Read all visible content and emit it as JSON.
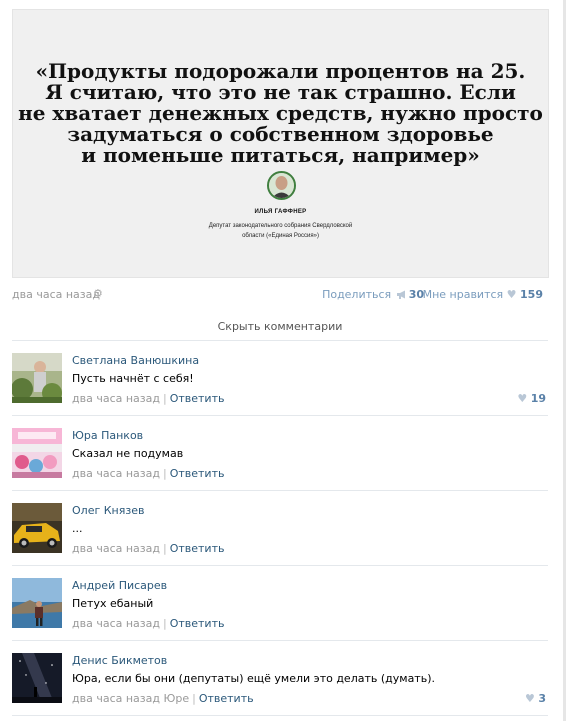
{
  "post": {
    "quote_lines": [
      "«Продукты подорожали процентов на 25.",
      "Я считаю, что это не так страшно. Если",
      "не хватает денежных средств, нужно просто",
      "задуматься о собственном здоровье",
      "и поменьше питаться, например»"
    ],
    "author_name": "ИЛЬЯ ГАФФНЕР",
    "author_role_lines": [
      "Депутат законодательного собрания Свердловской",
      "области («Единая Россия»)"
    ],
    "time": "два часа назад",
    "share_label": "Поделиться",
    "share_count": "30",
    "like_label": "Мне нравится",
    "like_count": "159",
    "hide_comments_label": "Скрыть комментарии"
  },
  "comments": [
    {
      "name": "Светлана Ванюшкина",
      "text": "Пусть начнёт с себя!",
      "time": "два часа назад",
      "reply": "Ответить",
      "likes": "19",
      "avatar": "woman-garden-avatar"
    },
    {
      "name": "Юра Панков",
      "text": "Сказал не подумав",
      "time": "два часа назад",
      "reply": "Ответить",
      "likes": "",
      "avatar": "pink-toys-avatar"
    },
    {
      "name": "Олег Князев",
      "text": "...",
      "time": "два часа назад",
      "reply": "Ответить",
      "likes": "",
      "avatar": "yellow-car-avatar"
    },
    {
      "name": "Андрей Писарев",
      "text": "Петух ебаный",
      "time": "два часа назад",
      "reply": "Ответить",
      "likes": "",
      "avatar": "seaside-man-avatar"
    },
    {
      "name": "Денис Бикметов",
      "text": "Юра, если бы они (депутаты) ещё умели это делать (думать).",
      "time": "два часа назад Юре",
      "reply": "Ответить",
      "likes": "3",
      "avatar": "night-sky-avatar"
    }
  ],
  "colors": {
    "link": "#2b587a",
    "meta": "#999999",
    "accent_count": "#5a81a8",
    "quote_bg": "#f0f0f0"
  }
}
